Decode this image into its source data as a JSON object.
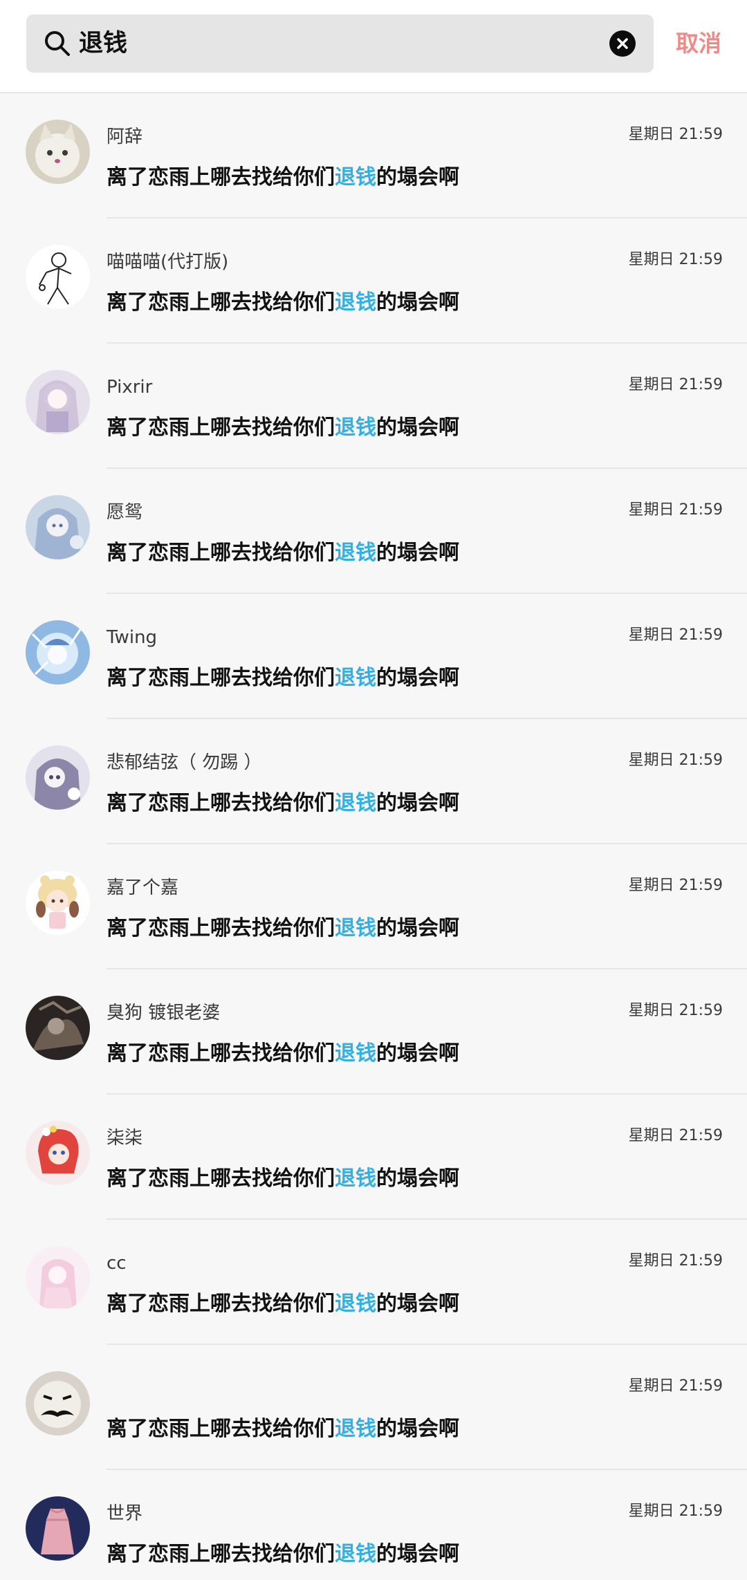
{
  "search": {
    "query": "退钱",
    "cancel_label": "取消"
  },
  "colors": {
    "highlight": "#33b0e2",
    "cancel": "#f08a88"
  },
  "results": [
    {
      "name": "阿辞",
      "time": "星期日 21:59",
      "msg_before": "离了恋雨上哪去找给你们",
      "msg_match": "退钱",
      "msg_after": "的塌会啊",
      "avatar": "cat"
    },
    {
      "name": "喵喵喵(代打版)",
      "time": "星期日 21:59",
      "msg_before": "离了恋雨上哪去找给你们",
      "msg_match": "退钱",
      "msg_after": "的塌会啊",
      "avatar": "sketch"
    },
    {
      "name": "Pixrir",
      "time": "星期日 21:59",
      "msg_before": "离了恋雨上哪去找给你们",
      "msg_match": "退钱",
      "msg_after": "的塌会啊",
      "avatar": "anime-lavender"
    },
    {
      "name": "愿鸳",
      "time": "星期日 21:59",
      "msg_before": "离了恋雨上哪去找给你们",
      "msg_match": "退钱",
      "msg_after": "的塌会啊",
      "avatar": "anime-blue"
    },
    {
      "name": "Twing",
      "time": "星期日 21:59",
      "msg_before": "离了恋雨上哪去找给你们",
      "msg_match": "退钱",
      "msg_after": "的塌会啊",
      "avatar": "anime-ice"
    },
    {
      "name": "悲郁结弦（ 勿踢 ）",
      "time": "星期日 21:59",
      "msg_before": "离了恋雨上哪去找给你们",
      "msg_match": "退钱",
      "msg_after": "的塌会啊",
      "avatar": "anime-purple"
    },
    {
      "name": "嘉了个嘉",
      "time": "星期日 21:59",
      "msg_before": "离了恋雨上哪去找给你们",
      "msg_match": "退钱",
      "msg_after": "的塌会啊",
      "avatar": "chibi"
    },
    {
      "name": "臭狗 镀银老婆",
      "time": "星期日 21:59",
      "msg_before": "离了恋雨上哪去找给你们",
      "msg_match": "退钱",
      "msg_after": "的塌会啊",
      "avatar": "dark"
    },
    {
      "name": "柒柒",
      "time": "星期日 21:59",
      "msg_before": "离了恋雨上哪去找给你们",
      "msg_match": "退钱",
      "msg_after": "的塌会啊",
      "avatar": "red-hair"
    },
    {
      "name": "cc",
      "time": "星期日 21:59",
      "msg_before": "离了恋雨上哪去找给你们",
      "msg_match": "退钱",
      "msg_after": "的塌会啊",
      "avatar": "pink"
    },
    {
      "name": "",
      "time": "星期日 21:59",
      "msg_before": "离了恋雨上哪去找给你们",
      "msg_match": "退钱",
      "msg_after": "的塌会啊",
      "avatar": "mustache"
    },
    {
      "name": "世界",
      "time": "星期日 21:59",
      "msg_before": "离了恋雨上哪去找给你们",
      "msg_match": "退钱",
      "msg_after": "的塌会啊",
      "avatar": "dress"
    }
  ]
}
